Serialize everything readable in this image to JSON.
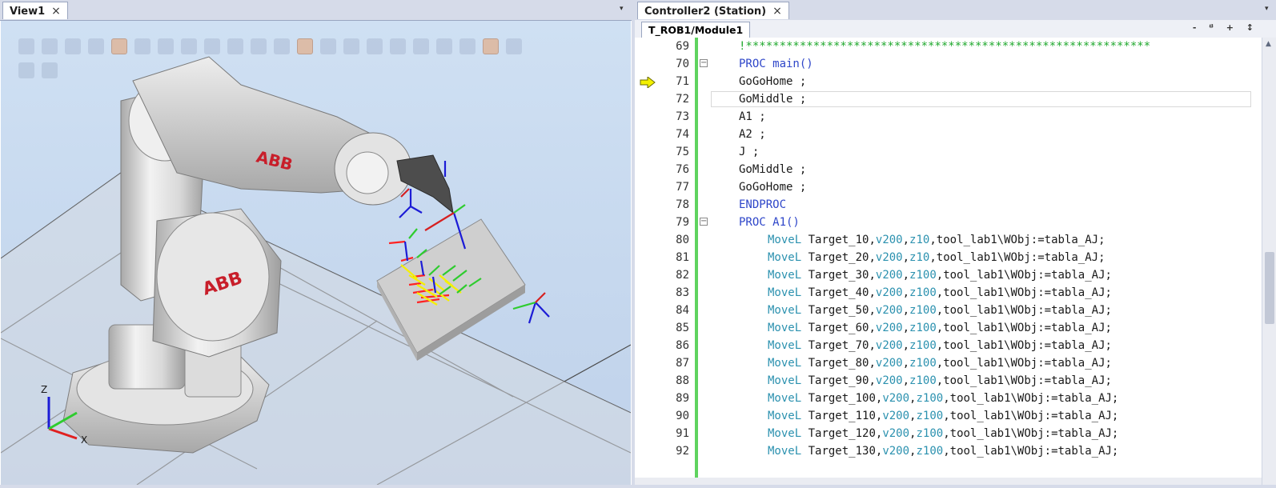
{
  "left": {
    "tab_title": "View1",
    "tab_close": "×",
    "menu_arrow": "▾",
    "robot_brand_upper": "ABB",
    "robot_brand_lower": "ABB",
    "axes": {
      "z": "Z",
      "x": "X"
    }
  },
  "right": {
    "tab_title": "Controller2 (Station)",
    "tab_close": "×",
    "menu_arrow": "▾",
    "doc_tab_title": "T_ROB1/Module1",
    "doc_tools": "- ᴽ + ↕",
    "lines": [
      {
        "num": "69",
        "code": "!************************************************************",
        "style": "comment"
      },
      {
        "num": "70",
        "code": "PROC main()",
        "style": "kw",
        "fold": "−"
      },
      {
        "num": "71",
        "code": "GoGoHome ;",
        "style": "plain"
      },
      {
        "num": "72",
        "code": "GoMiddle ;",
        "style": "plain"
      },
      {
        "num": "73",
        "code": "A1 ;",
        "style": "plain"
      },
      {
        "num": "74",
        "code": "A2 ;",
        "style": "plain"
      },
      {
        "num": "75",
        "code": "J ;",
        "style": "plain"
      },
      {
        "num": "76",
        "code": "GoMiddle ;",
        "style": "plain"
      },
      {
        "num": "77",
        "code": "GoGoHome ;",
        "style": "plain"
      },
      {
        "num": "78",
        "code": "ENDPROC",
        "style": "kw"
      },
      {
        "num": "79",
        "code": "PROC A1()",
        "style": "kw",
        "fold": "−"
      },
      {
        "num": "80",
        "target": "Target_10",
        "zone": "z10"
      },
      {
        "num": "81",
        "target": "Target_20",
        "zone": "z10"
      },
      {
        "num": "82",
        "target": "Target_30",
        "zone": "z100"
      },
      {
        "num": "83",
        "target": "Target_40",
        "zone": "z100"
      },
      {
        "num": "84",
        "target": "Target_50",
        "zone": "z100"
      },
      {
        "num": "85",
        "target": "Target_60",
        "zone": "z100"
      },
      {
        "num": "86",
        "target": "Target_70",
        "zone": "z100"
      },
      {
        "num": "87",
        "target": "Target_80",
        "zone": "z100"
      },
      {
        "num": "88",
        "target": "Target_90",
        "zone": "z100"
      },
      {
        "num": "89",
        "target": "Target_100",
        "zone": "z100"
      },
      {
        "num": "90",
        "target": "Target_110",
        "zone": "z100"
      },
      {
        "num": "91",
        "target": "Target_120",
        "zone": "z100"
      },
      {
        "num": "92",
        "target": "Target_130",
        "zone": "z100"
      }
    ],
    "move_instr": "MoveL",
    "speed": "v200",
    "tool_wobj": "tool_lab1\\WObj:=tabla_AJ;"
  },
  "colors": {
    "keyword": "#2e46c9",
    "instruction": "#2b91af",
    "comment": "#1fa82d",
    "change_bar": "#5fd35f",
    "pointer": "#f3f000"
  },
  "icons": [
    "close-icon",
    "chevron-down-icon",
    "fold-minus-icon",
    "program-pointer-arrow-icon"
  ]
}
